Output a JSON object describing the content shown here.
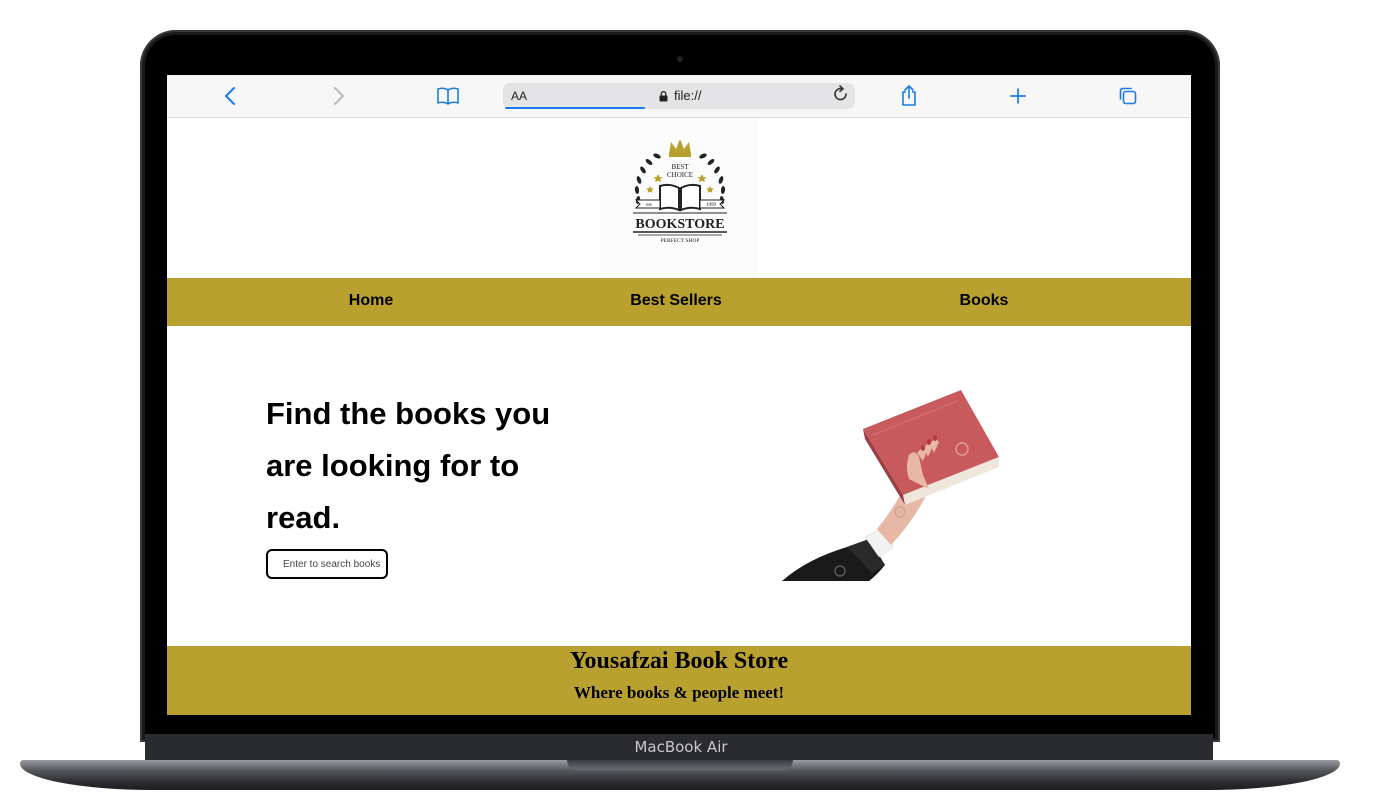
{
  "device": {
    "model_label": "MacBook Air"
  },
  "browser": {
    "text_size_label": "AA",
    "url": "file://",
    "icons": {
      "back": "chevron-left-icon",
      "forward": "chevron-right-icon",
      "bookmarks": "book-icon",
      "lock": "lock-icon",
      "reload": "reload-icon",
      "share": "share-icon",
      "new_tab": "plus-icon",
      "tabs": "tabs-icon"
    },
    "accent_color": "#1a7be6"
  },
  "site": {
    "logo": {
      "line1": "BEST",
      "line2": "CHOICE",
      "name": "BOOKSTORE",
      "tagline": "PERFECT SHOP",
      "left_ribbon": "est",
      "right_ribbon": "1999"
    },
    "nav": [
      {
        "label": "Home"
      },
      {
        "label": "Best Sellers"
      },
      {
        "label": "Books"
      }
    ],
    "hero": {
      "headline": "Find the books you are looking for to read.",
      "search_placeholder": "Enter to search books"
    },
    "footer": {
      "title": "Yousafzai Book Store",
      "tagline": "Where books & people meet!"
    },
    "brand_color": "#b9a130"
  }
}
